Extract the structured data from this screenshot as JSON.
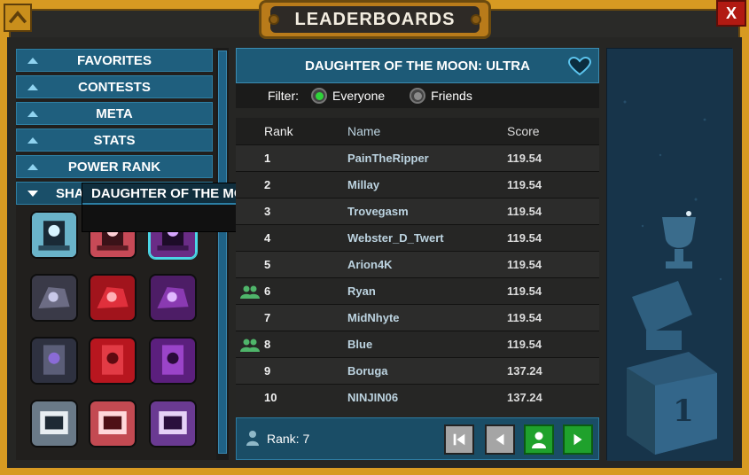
{
  "window": {
    "title": "LEADERBOARDS",
    "close_label": "X"
  },
  "sidebar": {
    "categories": [
      {
        "label": "FAVORITES"
      },
      {
        "label": "CONTESTS"
      },
      {
        "label": "META"
      },
      {
        "label": "STATS"
      },
      {
        "label": "POWER RANK"
      },
      {
        "label": "SHA"
      }
    ]
  },
  "tooltip": {
    "title": "DAUGHTER OF THE MOON: NORMAL"
  },
  "board": {
    "title": "DAUGHTER OF THE MOON: ULTRA",
    "filter_label": "Filter:",
    "filter_options": [
      {
        "label": "Everyone",
        "selected": true
      },
      {
        "label": "Friends",
        "selected": false
      }
    ],
    "columns": [
      "Rank",
      "Name",
      "Score"
    ],
    "rows": [
      {
        "rank": "1",
        "name": "PainTheRipper",
        "score": "119.54",
        "friend": false
      },
      {
        "rank": "2",
        "name": "Millay",
        "score": "119.54",
        "friend": false
      },
      {
        "rank": "3",
        "name": "Trovegasm",
        "score": "119.54",
        "friend": false
      },
      {
        "rank": "4",
        "name": "Webster_D_Twert",
        "score": "119.54",
        "friend": false
      },
      {
        "rank": "5",
        "name": "Arion4K",
        "score": "119.54",
        "friend": false
      },
      {
        "rank": "6",
        "name": "Ryan",
        "score": "119.54",
        "friend": true
      },
      {
        "rank": "7",
        "name": "MidNhyte",
        "score": "119.54",
        "friend": false
      },
      {
        "rank": "8",
        "name": "Blue",
        "score": "119.54",
        "friend": true
      },
      {
        "rank": "9",
        "name": "Boruga",
        "score": "137.24",
        "friend": false
      },
      {
        "rank": "10",
        "name": "NINJIN06",
        "score": "137.24",
        "friend": false
      }
    ],
    "my_rank_label": "Rank:",
    "my_rank_value": "7"
  },
  "colors": {
    "frame": "#d79a22",
    "accent": "#1f5f7e",
    "friend": "#4fb56a",
    "nav_green": "#1fa12c"
  }
}
